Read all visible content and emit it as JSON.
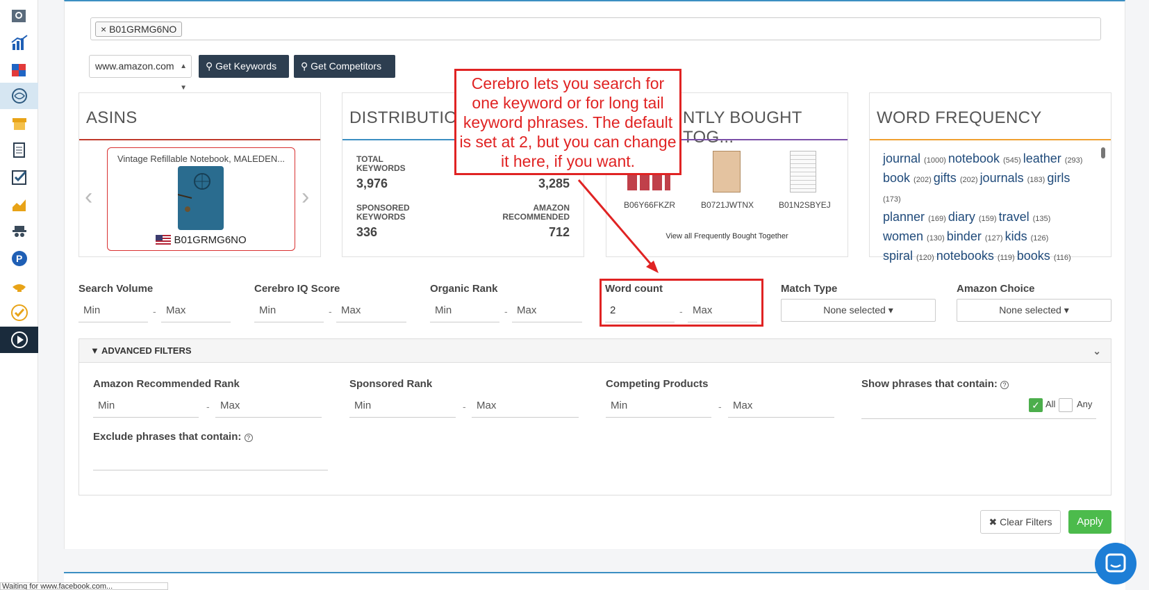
{
  "sidebar": {
    "icons": [
      "magnifier-box-icon",
      "bar-chart-icon",
      "puzzle-icon",
      "brain-icon",
      "inventory-icon",
      "document-icon",
      "checklist-icon",
      "area-chart-icon",
      "spy-icon",
      "p-circle-icon",
      "genie-lamp-icon",
      "check-circle-icon",
      "play-circle-icon"
    ]
  },
  "search": {
    "asin_tag": "B01GRMG6NO",
    "tag_remove": "×"
  },
  "marketplace": {
    "selected": "www.amazon.com"
  },
  "buttons": {
    "get_keywords": "Get Keywords",
    "get_competitors": "Get Competitors",
    "clear_filters": "Clear Filters",
    "apply": "Apply"
  },
  "asins_card": {
    "title": "ASINS",
    "product_title": "Vintage Refillable Notebook, MALEDEN...",
    "product_asin": "B01GRMG6NO",
    "accent": "#c0392b"
  },
  "distribution_card": {
    "title": "DISTRIBUTION",
    "total_keywords_label": "TOTAL KEYWORDS",
    "total_keywords": "3,976",
    "organic_value": "3,285",
    "sponsored_label": "SPONSORED KEYWORDS",
    "sponsored_value": "336",
    "amazon_rec_label": "AMAZON RECOMMENDED",
    "amazon_rec_value": "712",
    "accent": "#3b8fc2"
  },
  "fbt_card": {
    "title": "NTLY BOUGHT TOG...",
    "products": [
      "B06Y66FKZR",
      "B0721JWTNX",
      "B01N2SBYEJ"
    ],
    "view_all": "View all Frequently Bought Together",
    "accent": "#7b4fa8"
  },
  "word_frequency": {
    "title": "WORD FREQUENCY",
    "accent": "#f0a030",
    "rows": [
      [
        [
          "journal",
          "(1000)"
        ],
        [
          "notebook",
          "(545)"
        ],
        [
          "leather",
          "(293)"
        ]
      ],
      [
        [
          "book",
          "(202)"
        ],
        [
          "gifts",
          "(202)"
        ],
        [
          "journals",
          "(183)"
        ],
        [
          "girls",
          "(173)"
        ]
      ],
      [
        [
          "planner",
          "(169)"
        ],
        [
          "diary",
          "(159)"
        ],
        [
          "travel",
          "(135)"
        ]
      ],
      [
        [
          "women",
          "(130)"
        ],
        [
          "binder",
          "(127)"
        ],
        [
          "kids",
          "(126)"
        ]
      ],
      [
        [
          "spiral",
          "(120)"
        ],
        [
          "notebooks",
          "(119)"
        ],
        [
          "books",
          "(116)"
        ]
      ]
    ]
  },
  "filters": {
    "search_volume": "Search Volume",
    "cerebro_iq": "Cerebro IQ Score",
    "organic_rank": "Organic Rank",
    "word_count": "Word count",
    "match_type": "Match Type",
    "amazon_choice": "Amazon Choice",
    "min": "Min",
    "max": "Max",
    "word_count_min_value": "2",
    "none_selected": "None selected",
    "dash": "-"
  },
  "advanced": {
    "header": "ADVANCED FILTERS",
    "amazon_rec_rank": "Amazon Recommended Rank",
    "sponsored_rank": "Sponsored Rank",
    "competing_products": "Competing Products",
    "show_phrases": "Show phrases that contain:",
    "all": "All",
    "any": "Any",
    "exclude_phrases": "Exclude phrases that contain:"
  },
  "callout": {
    "text": "Cerebro lets you search for one keyword or for long tail keyword phrases. The default is set at 2, but you can change it here, if you want."
  },
  "status_bar": "Waiting for www.facebook.com..."
}
